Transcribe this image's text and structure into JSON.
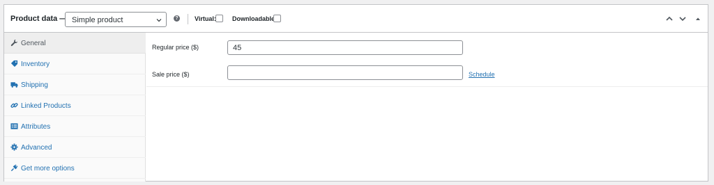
{
  "header": {
    "title": "Product data —",
    "product_type": "Simple product",
    "help_icon": "?",
    "virtual_label": "Virtual:",
    "virtual_checked": false,
    "downloadable_label": "Downloadable:",
    "downloadable_checked": false
  },
  "tabs": [
    {
      "label": "General",
      "icon": "wrench-icon",
      "active": true
    },
    {
      "label": "Inventory",
      "icon": "tag-icon",
      "active": false
    },
    {
      "label": "Shipping",
      "icon": "truck-icon",
      "active": false
    },
    {
      "label": "Linked Products",
      "icon": "link-icon",
      "active": false
    },
    {
      "label": "Attributes",
      "icon": "list-icon",
      "active": false
    },
    {
      "label": "Advanced",
      "icon": "gear-icon",
      "active": false
    },
    {
      "label": "Get more options",
      "icon": "plugin-icon",
      "active": false
    }
  ],
  "general": {
    "regular_price_label": "Regular price ($)",
    "regular_price_value": "45",
    "sale_price_label": "Sale price ($)",
    "sale_price_value": "",
    "schedule_link": "Schedule"
  },
  "colors": {
    "link": "#2271b1",
    "icon_active": "#50575e"
  }
}
